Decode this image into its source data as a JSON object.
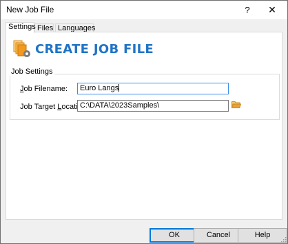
{
  "window": {
    "title": "New Job File",
    "help_glyph": "?",
    "close_glyph": "✕"
  },
  "tabs": [
    {
      "label": "Settings",
      "active": true
    },
    {
      "label": "Files",
      "active": false
    },
    {
      "label": "Languages",
      "active": false
    }
  ],
  "header": {
    "title": "CREATE JOB FILE",
    "icon": "create-job-file-icon"
  },
  "job_settings": {
    "legend": "Job Settings",
    "filename_label_mnemonic": "J",
    "filename_label_rest": "ob Filename:",
    "filename_value": "Euro Langs",
    "location_label_prefix": "Job Target ",
    "location_label_mnemonic": "L",
    "location_label_rest": "ocation:",
    "location_value": "C:\\DATA\\2023Samples\\",
    "browse_icon": "folder-open-icon"
  },
  "buttons": {
    "ok": "OK",
    "cancel": "Cancel",
    "help": "Help"
  },
  "colors": {
    "accent": "#1f74c6",
    "focus_border": "#3b8de8",
    "folder": "#e8a23a"
  }
}
